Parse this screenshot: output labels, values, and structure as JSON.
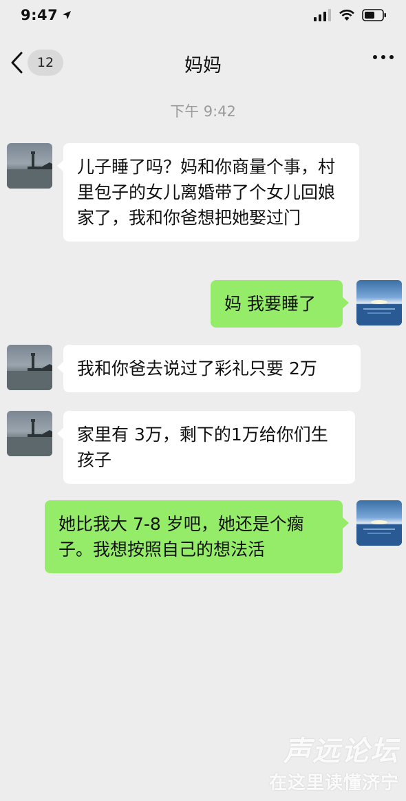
{
  "status_bar": {
    "time": "9:47"
  },
  "nav": {
    "back_badge": "12",
    "title": "妈妈"
  },
  "chat": {
    "timestamp": "下午 9:42",
    "messages": [
      {
        "sender": "mom",
        "text": "儿子睡了吗？妈和你商量个事，村里包子的女儿离婚带了个女儿回娘家了，我和你爸想把她娶过门"
      },
      {
        "sender": "me",
        "text": "妈 我要睡了"
      },
      {
        "sender": "mom",
        "text": "我和你爸去说过了彩礼只要 2万"
      },
      {
        "sender": "mom",
        "text": "家里有 3万，剩下的1万给你们生孩子"
      },
      {
        "sender": "me",
        "text": "她比我大 7-8 岁吧，她还是个瘸子。我想按照自己的想法活"
      }
    ]
  },
  "watermark": {
    "line1": "声远论坛",
    "line2": "在这里读懂济宁"
  }
}
